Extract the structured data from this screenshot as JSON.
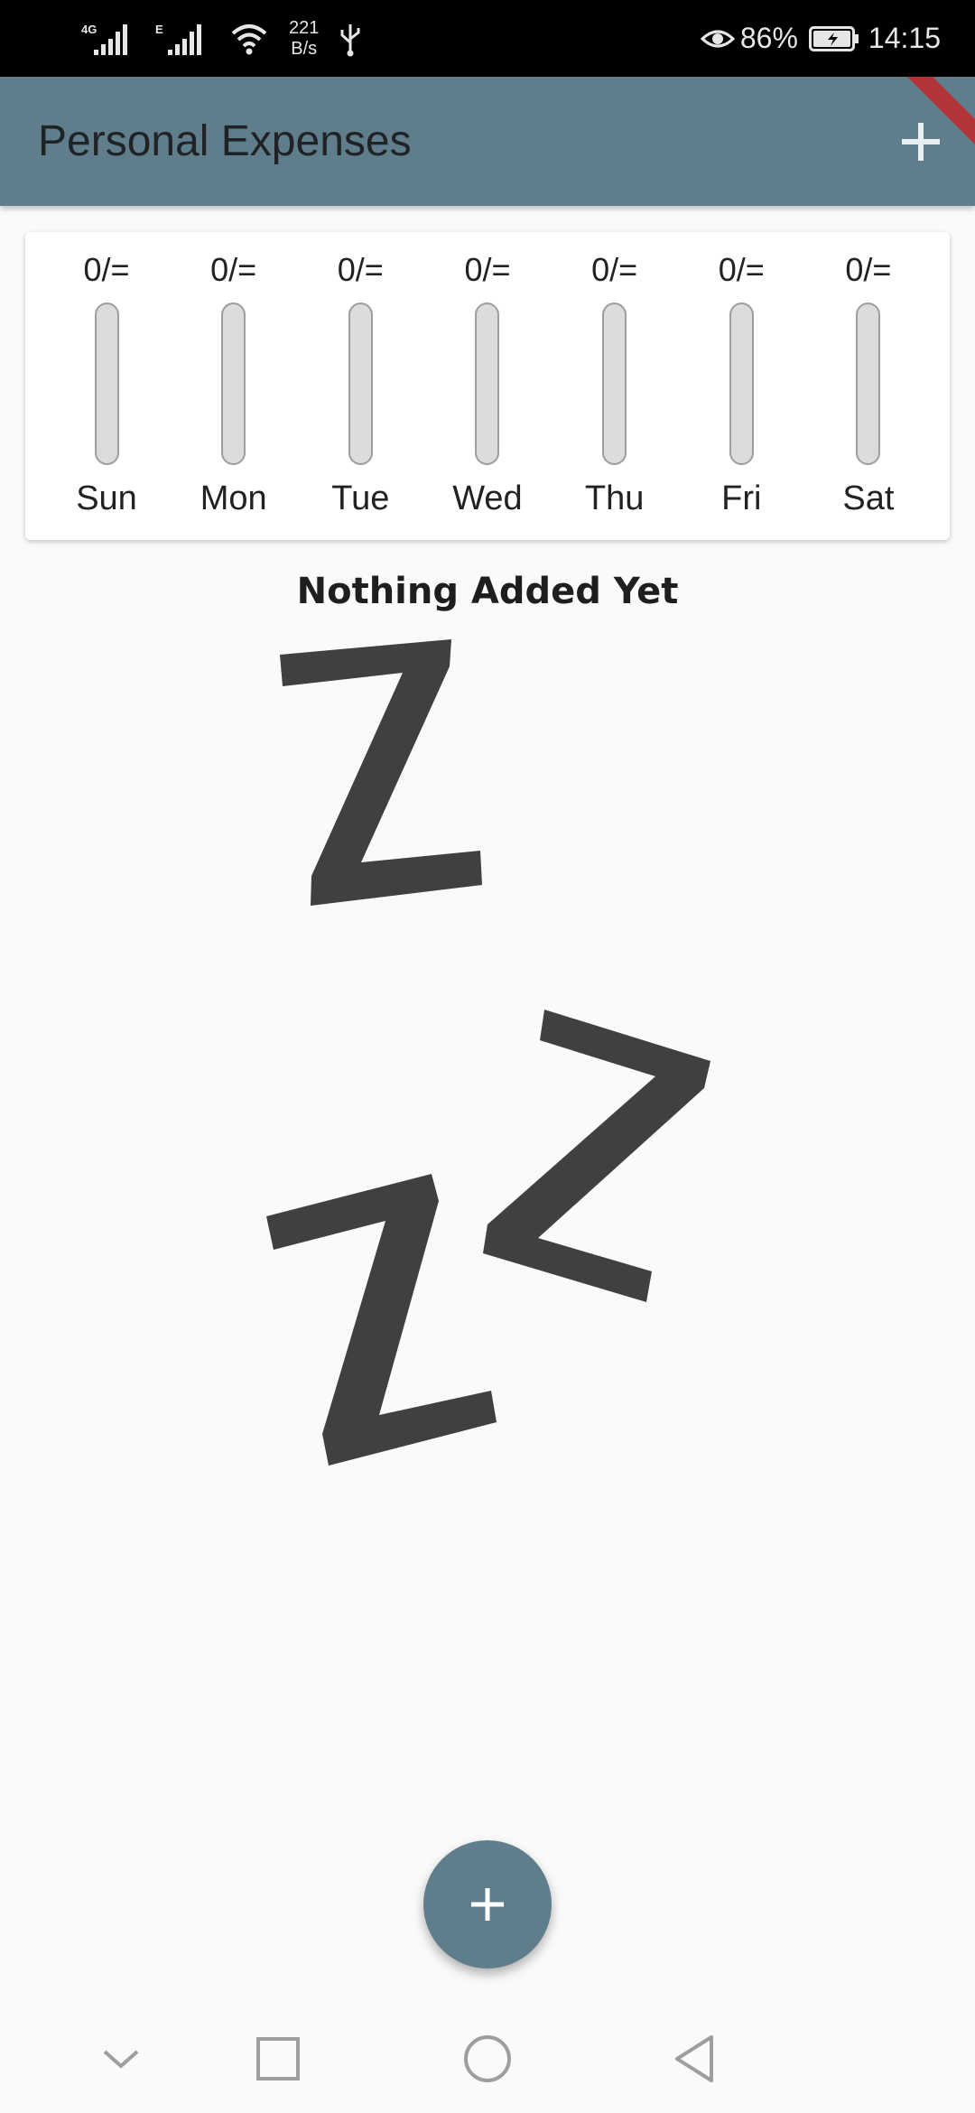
{
  "status_bar": {
    "network_1": "4G",
    "network_2": "E",
    "speed_value": "221",
    "speed_unit": "B/s",
    "battery": "86%",
    "time": "14:15"
  },
  "app_bar": {
    "title": "Personal Expenses",
    "add_icon": "plus-icon"
  },
  "chart": {
    "days": [
      {
        "label": "Sun",
        "amount": "0/=",
        "fraction": 0
      },
      {
        "label": "Mon",
        "amount": "0/=",
        "fraction": 0
      },
      {
        "label": "Tue",
        "amount": "0/=",
        "fraction": 0
      },
      {
        "label": "Wed",
        "amount": "0/=",
        "fraction": 0
      },
      {
        "label": "Thu",
        "amount": "0/=",
        "fraction": 0
      },
      {
        "label": "Fri",
        "amount": "0/=",
        "fraction": 0
      },
      {
        "label": "Sat",
        "amount": "0/=",
        "fraction": 0
      }
    ]
  },
  "empty_state": {
    "title": "Nothing Added Yet",
    "image": "zzz-sleep-icon"
  },
  "fab": {
    "icon": "plus-icon"
  },
  "colors": {
    "primary": "#607d8b",
    "status_bar": "#000000",
    "background": "#fafafa",
    "bar_track": "#dcdcdc"
  }
}
